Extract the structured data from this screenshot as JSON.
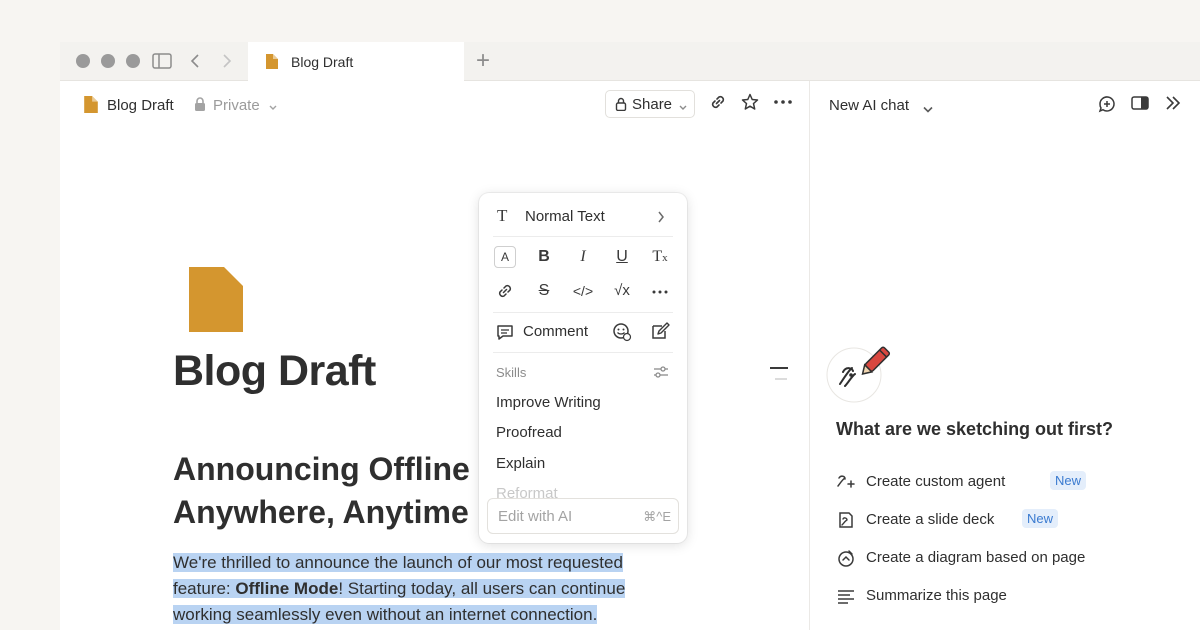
{
  "window": {
    "tab_title": "Blog Draft",
    "new_tab_symbol": "+"
  },
  "doc_header": {
    "page_name": "Blog Draft",
    "privacy": "Private",
    "share_label": "Share"
  },
  "doc": {
    "title": "Blog Draft",
    "heading_line1": "Announcing Offline M",
    "heading_line2": "Anywhere, Anytime",
    "para_part1": "We're thrilled to announce the launch of our most requested feature: ",
    "para_bold": "Offline Mode",
    "para_part2": "! Starting today, all users can continue working seamlessly even without an internet connection."
  },
  "format_menu": {
    "block_type": "Normal Text",
    "comment_label": "Comment",
    "skills_heading": "Skills",
    "skills": [
      "Improve Writing",
      "Proofread",
      "Explain",
      "Reformat"
    ],
    "prompt_placeholder": "Edit with AI",
    "prompt_shortcut": "⌘^E"
  },
  "ai_panel": {
    "chat_title": "New AI chat",
    "question": "What are we sketching out first?",
    "suggestions": [
      {
        "label": "Create custom agent",
        "badge": "New",
        "icon": "agent-icon"
      },
      {
        "label": "Create a slide deck",
        "badge": "New",
        "icon": "slide-deck-icon"
      },
      {
        "label": "Create a diagram based on page",
        "badge": "",
        "icon": "diagram-icon"
      },
      {
        "label": "Summarize this page",
        "badge": "",
        "icon": "summarize-icon"
      }
    ]
  },
  "colors": {
    "accent_doc": "#d4962f",
    "selection": "#b9d3f2",
    "badge_bg": "#e4eefb",
    "badge_text": "#3a7ad0"
  }
}
